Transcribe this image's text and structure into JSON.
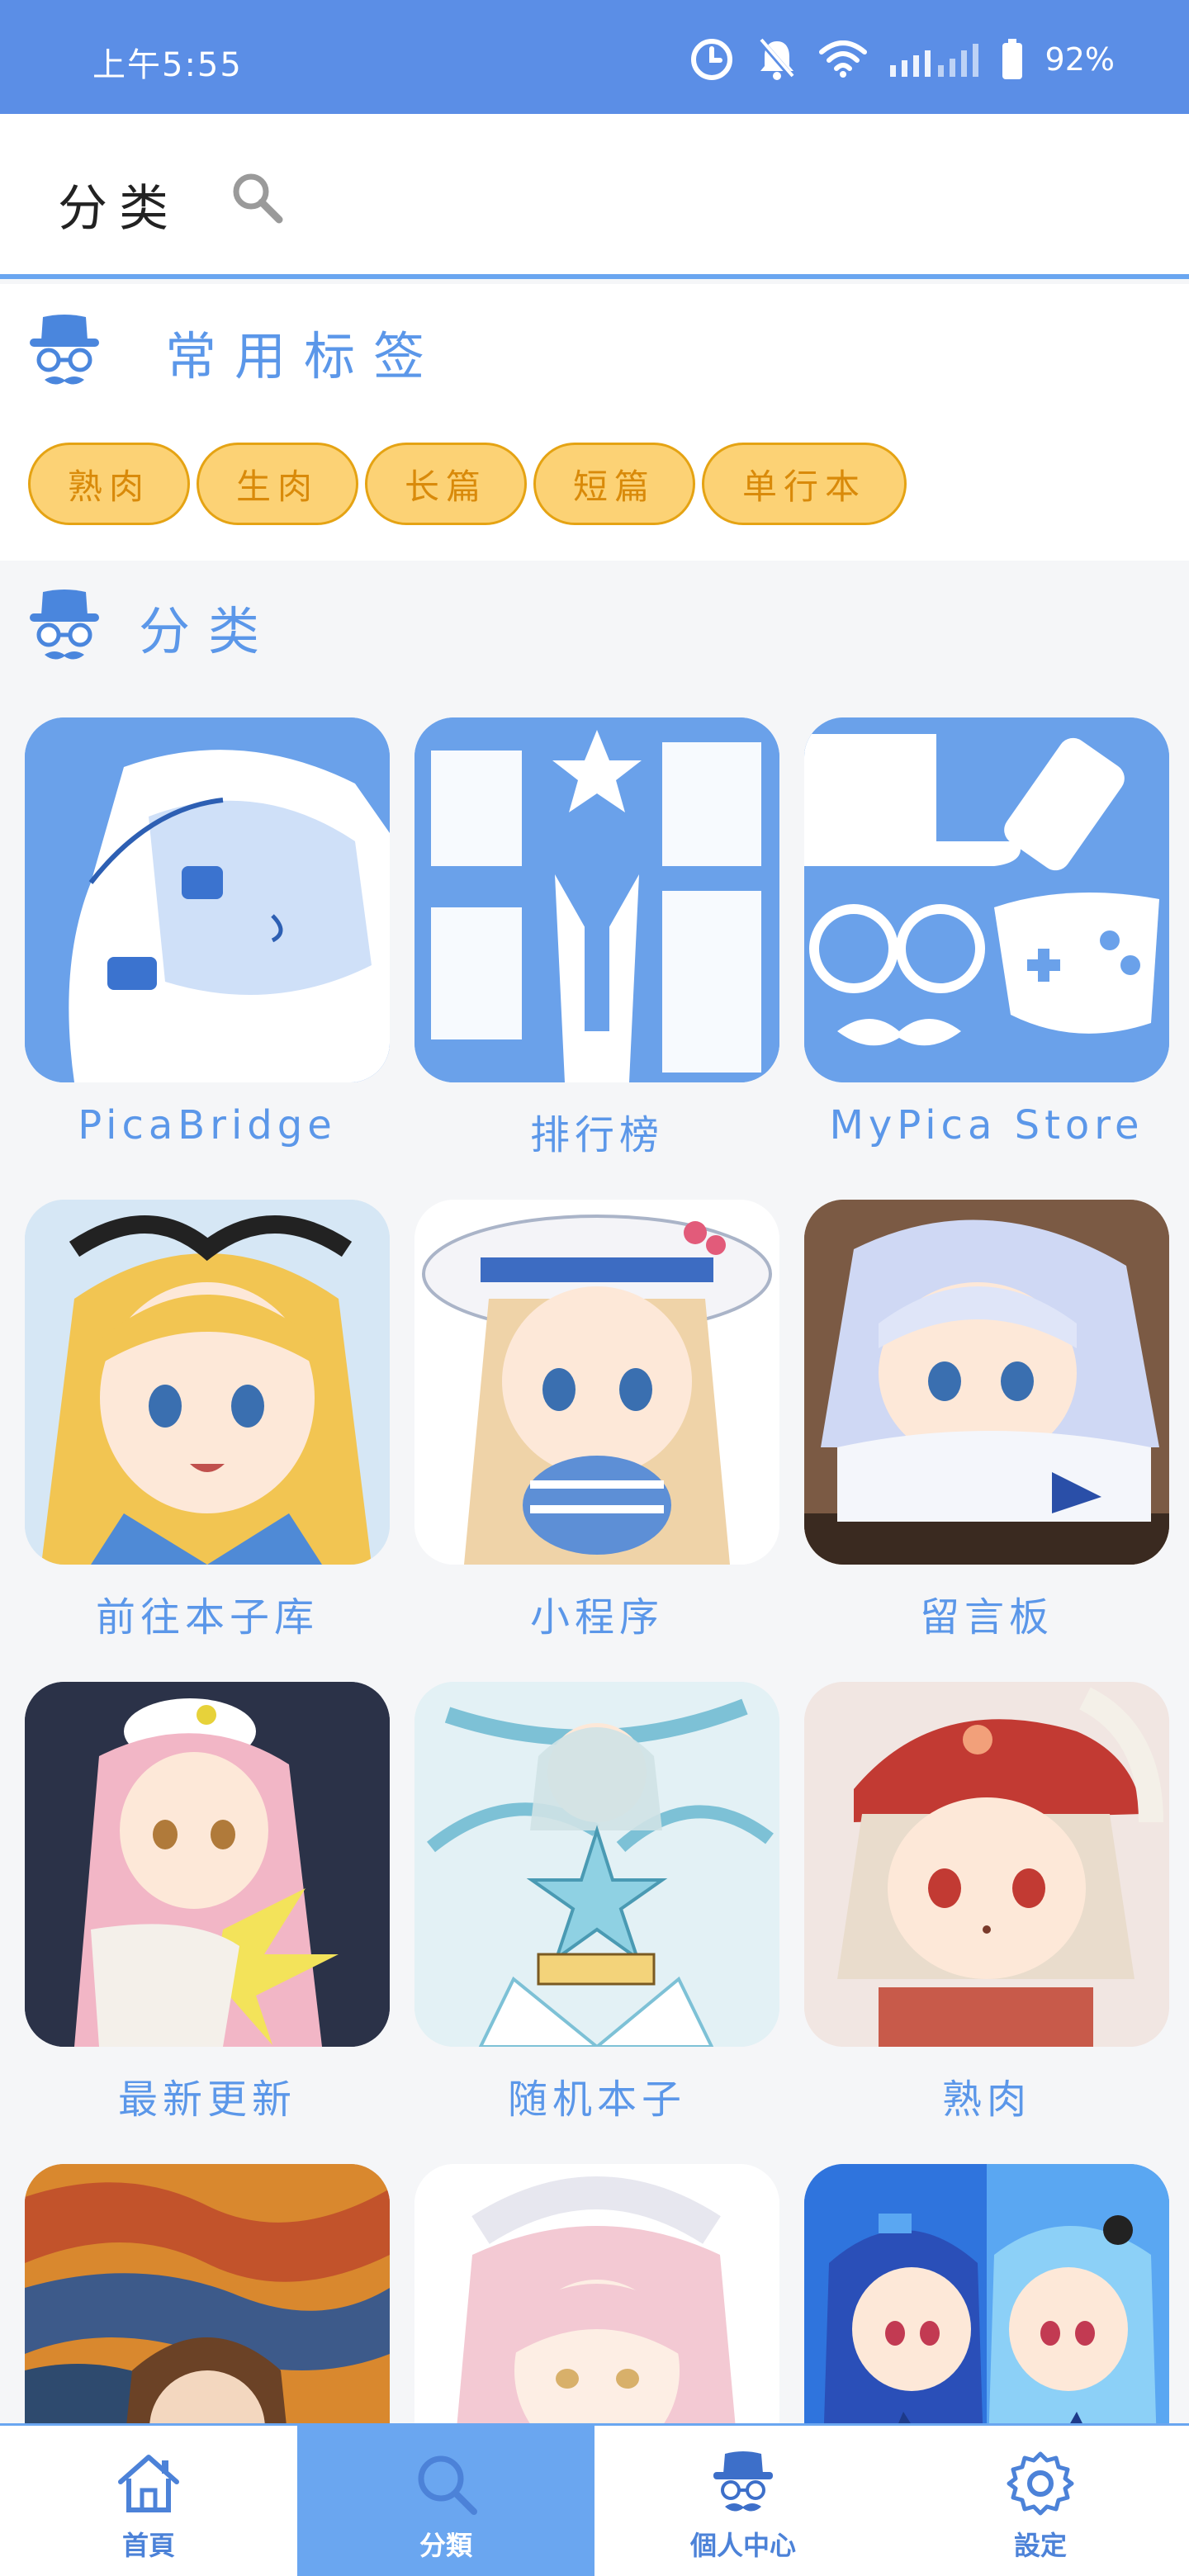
{
  "status_bar": {
    "time": "上午5:55",
    "battery_text": "92%",
    "icons": [
      "alarm-icon",
      "mute-icon",
      "wifi-icon",
      "signal-icon",
      "battery-icon"
    ]
  },
  "app_bar": {
    "title": "分类",
    "search_icon": "search-icon"
  },
  "tags_section": {
    "title": "常用标签",
    "tags": [
      "熟肉",
      "生肉",
      "长篇",
      "短篇",
      "单行本"
    ]
  },
  "categories_section": {
    "title": "分类",
    "items": [
      {
        "label": "PicaBridge",
        "image": "pica-bridge-illustration"
      },
      {
        "label": "排行榜",
        "image": "pica-leaderboard-graphic"
      },
      {
        "label": "MyPica  Store",
        "image": "mypica-store-graphic"
      },
      {
        "label": "前往本子库",
        "image": "anime-girl-alice"
      },
      {
        "label": "小程序",
        "image": "anime-girl-hat"
      },
      {
        "label": "留言板",
        "image": "anime-girl-silver-hair"
      },
      {
        "label": "最新更新",
        "image": "anime-girl-pink-hair"
      },
      {
        "label": "随机本子",
        "image": "the-star-card-art"
      },
      {
        "label": "熟肉",
        "image": "anime-girl-red-hat"
      },
      {
        "label": "",
        "image": "scream-parody"
      },
      {
        "label": "",
        "image": "anime-girl-pink-sketch"
      },
      {
        "label": "",
        "image": "two-anime-girls-blue"
      }
    ]
  },
  "bottom_nav": {
    "items": [
      {
        "label": "首頁",
        "icon": "home-icon"
      },
      {
        "label": "分類",
        "icon": "search-icon",
        "active": true
      },
      {
        "label": "個人中心",
        "icon": "profile-hat-icon"
      },
      {
        "label": "設定",
        "icon": "settings-gear-icon"
      }
    ]
  },
  "colors": {
    "status_bar": "#5b8ee6",
    "accent": "#5b97e9",
    "nav_active": "#6aa6f0",
    "chip_fill": "#fcd275",
    "chip_border": "#e5a313",
    "chip_text": "#d98a0a"
  }
}
